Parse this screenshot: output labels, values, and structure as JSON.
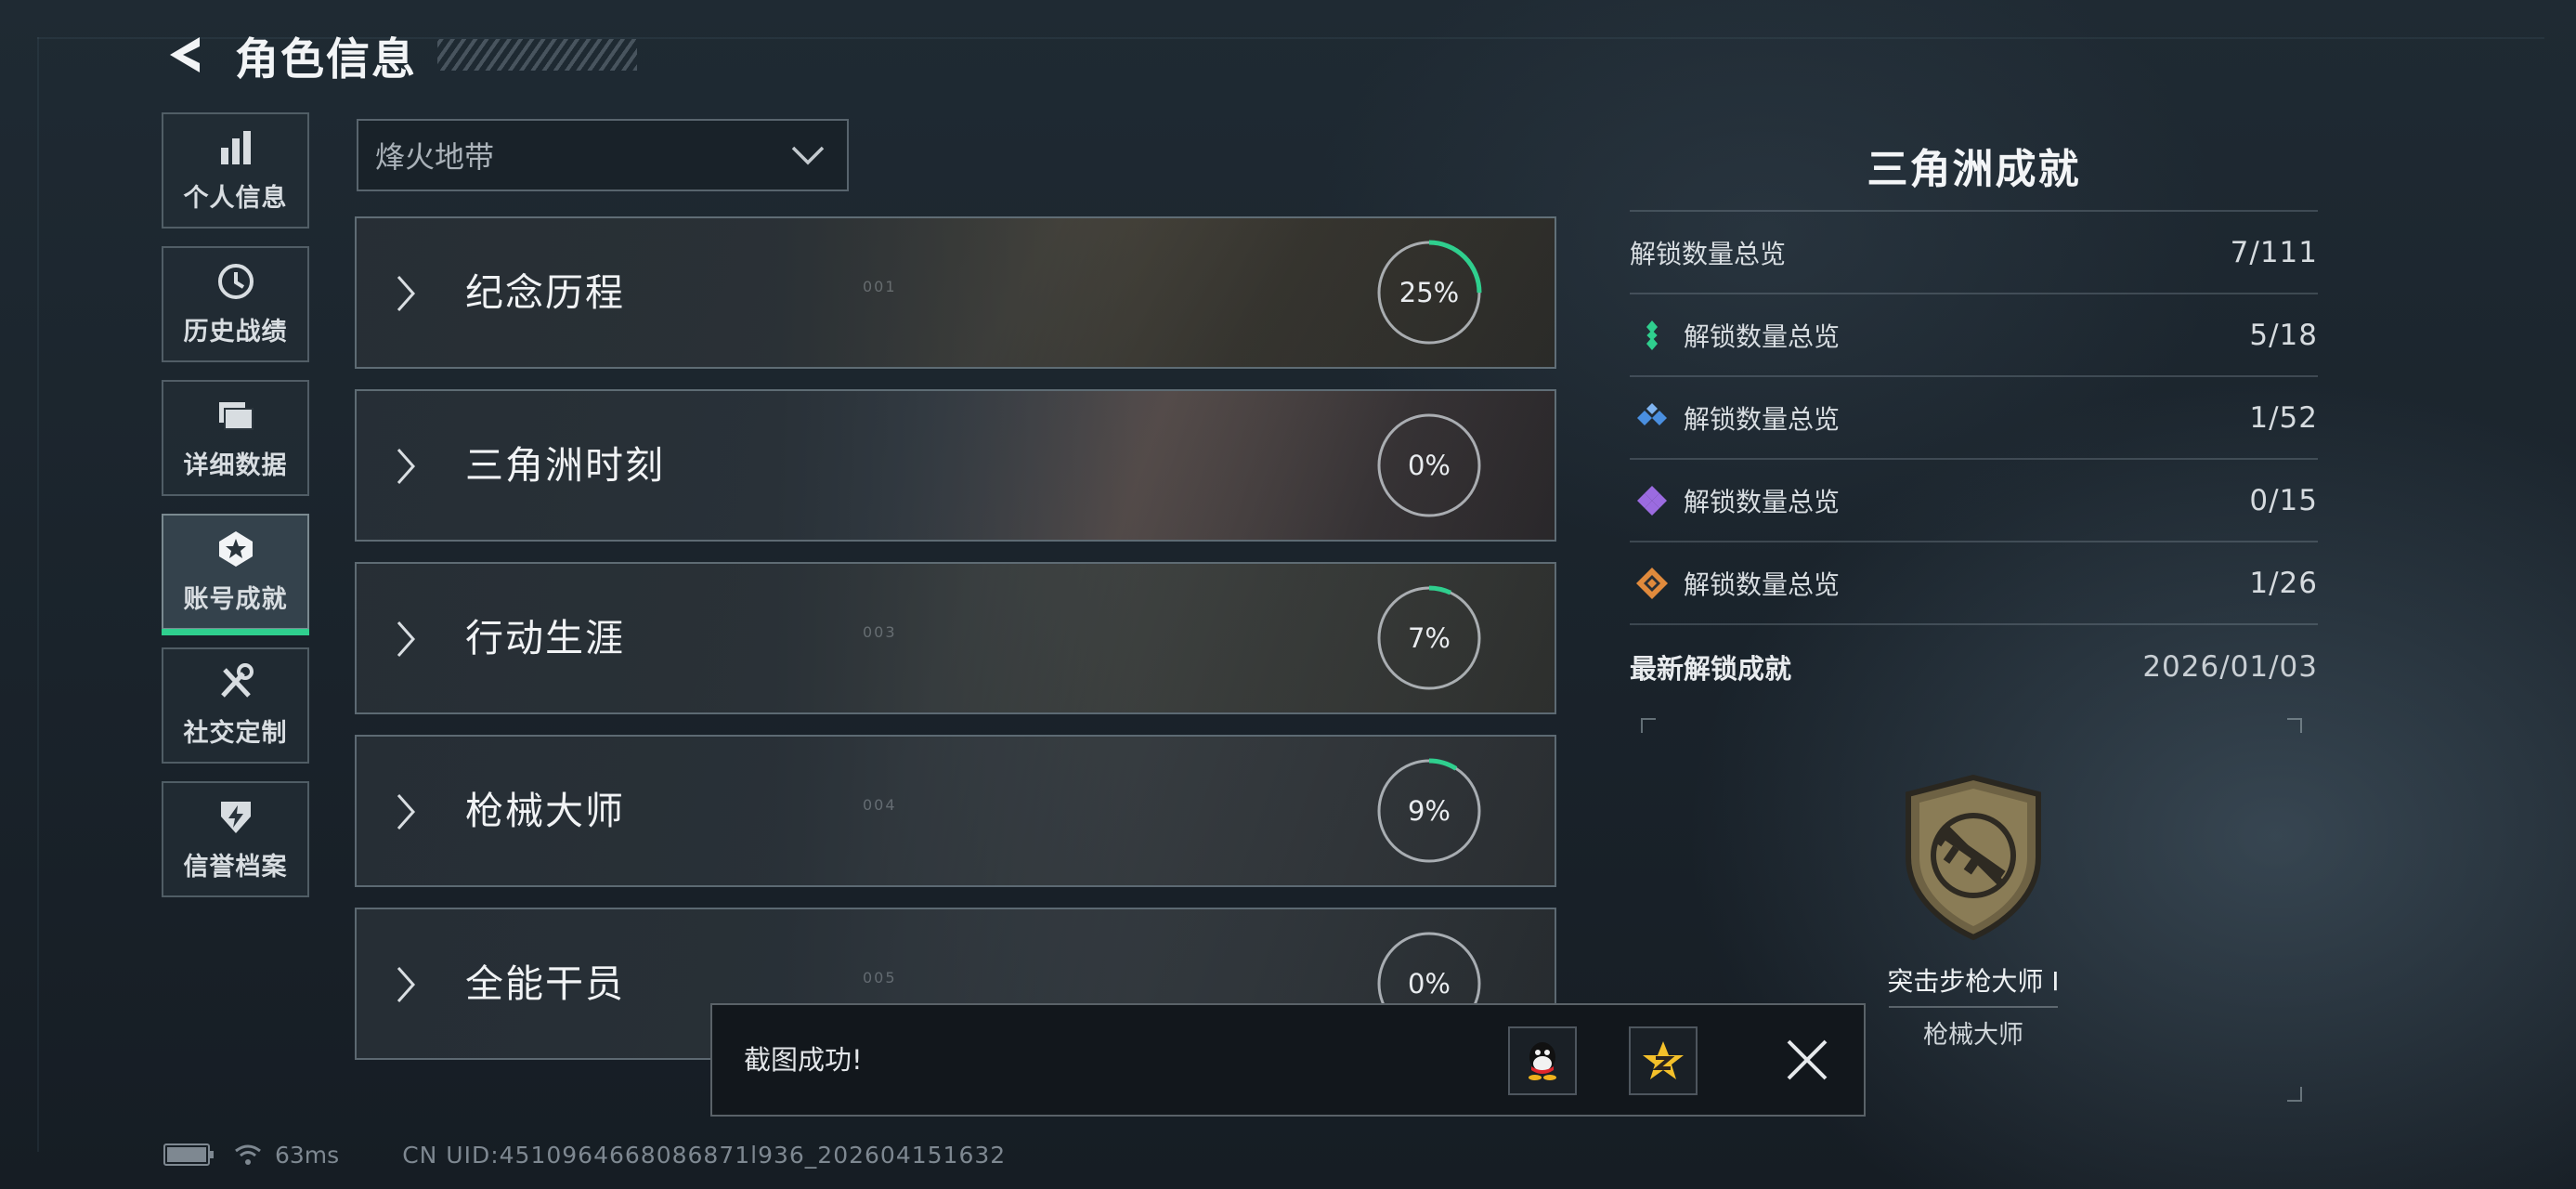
{
  "header": {
    "title": "角色信息"
  },
  "nav": [
    {
      "label": "个人信息",
      "icon": "bar-chart-icon",
      "active": false
    },
    {
      "label": "历史战绩",
      "icon": "history-clock-icon",
      "active": false
    },
    {
      "label": "详细数据",
      "icon": "folder-icon",
      "active": false
    },
    {
      "label": "账号成就",
      "icon": "achievement-badge-icon",
      "active": true
    },
    {
      "label": "社交定制",
      "icon": "tools-icon",
      "active": false
    },
    {
      "label": "信誉档案",
      "icon": "credit-shield-icon",
      "active": false
    }
  ],
  "dropdown": {
    "selected": "烽火地带"
  },
  "categories": [
    {
      "label": "纪念历程",
      "percent_text": "25%",
      "progress": 0.25,
      "number": "001"
    },
    {
      "label": "三角洲时刻",
      "percent_text": "0%",
      "progress": 0,
      "number": ""
    },
    {
      "label": "行动生涯",
      "percent_text": "7%",
      "progress": 0.07,
      "number": "003"
    },
    {
      "label": "枪械大师",
      "percent_text": "9%",
      "progress": 0.09,
      "number": "004"
    },
    {
      "label": "全能干员",
      "percent_text": "0%",
      "progress": 0,
      "number": "005"
    }
  ],
  "right_panel": {
    "title": "三角洲成就",
    "rows": [
      {
        "label": "解锁数量总览",
        "value": "7/111",
        "icon": ""
      },
      {
        "label": "解锁数量总览",
        "value": "5/18",
        "icon": "green-diamond-icon",
        "color": "#2fcf8e"
      },
      {
        "label": "解锁数量总览",
        "value": "1/52",
        "icon": "blue-diamond-icon",
        "color": "#4a8fe0"
      },
      {
        "label": "解锁数量总览",
        "value": "0/15",
        "icon": "purple-diamond-icon",
        "color": "#9b6be0"
      },
      {
        "label": "解锁数量总览",
        "value": "1/26",
        "icon": "orange-diamond-icon",
        "color": "#e08a3c"
      }
    ],
    "latest_label": "最新解锁成就",
    "latest_date": "2026/01/03",
    "medal": {
      "name": "突击步枪大师 I",
      "category": "枪械大师",
      "icon": "rifle-medal-icon"
    }
  },
  "toast": {
    "message": "截图成功!",
    "share_buttons": [
      "qq-icon",
      "qzone-icon"
    ],
    "close_icon": "close-icon"
  },
  "footer": {
    "ping": "63ms",
    "uid": "CN UID:4510964668086871l936_202604151632"
  },
  "colors": {
    "accent": "#2fcf8e"
  }
}
